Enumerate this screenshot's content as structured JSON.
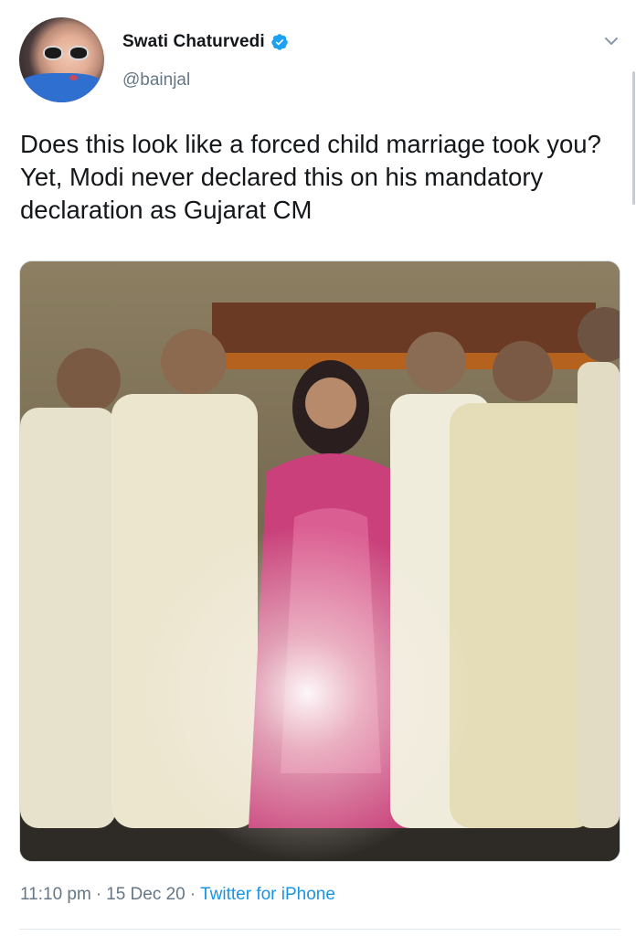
{
  "tweet": {
    "author": {
      "display_name": "Swati Chaturvedi",
      "handle": "@bainjal",
      "verified": true
    },
    "text": "Does this look like a forced child marriage took you? Yet, Modi never declared this on his mandatory declaration as Gujarat CM",
    "meta": {
      "time": "11:10 pm",
      "date": "15 Dec 20",
      "separator": "·",
      "source": "Twitter for iPhone"
    }
  },
  "icons": {
    "verified": "verified-badge-icon",
    "menu": "chevron-down-icon"
  },
  "colors": {
    "accent": "#1b95e0",
    "verified": "#1da1f2",
    "secondary_text": "#657786",
    "primary_text": "#14171a",
    "divider": "#e1e8ed"
  }
}
